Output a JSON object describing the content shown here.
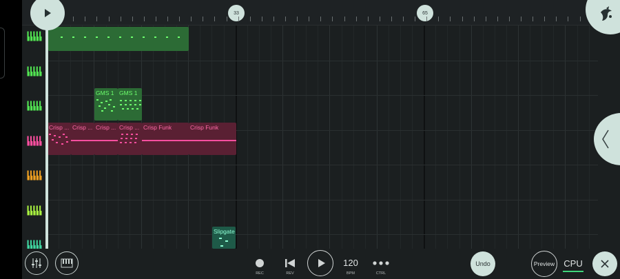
{
  "timeline": {
    "markers": [
      {
        "label": "33"
      },
      {
        "label": "65"
      }
    ]
  },
  "clips": {
    "gms_1a": "GMS 1",
    "gms_1b": "GMS 1",
    "crisp_1": "Crisp ...",
    "crisp_2": "Crisp ...",
    "crisp_3": "Crisp ...",
    "crisp_4": "Crisp ...",
    "crisp_funk_1": "Crisp Funk",
    "crisp_funk_2": "Crisp Funk",
    "slipgate": "Slipgate"
  },
  "transport": {
    "rec": "REC",
    "rev": "REV",
    "bpm_value": "120",
    "bpm": "BPM",
    "ctrl": "CTRL",
    "undo": "Undo",
    "preview": "Preview",
    "cpu": "CPU"
  },
  "colors": {
    "accent": "#cfe2dc",
    "green_clip": "#2f7a3a",
    "pink_clip": "#ff4fa0",
    "orange_track": "#f0a020",
    "teal_track": "#3fd6a0"
  },
  "icons": [
    "play-icon",
    "fl-fruit-logo-icon",
    "piano-keys-icon",
    "chevron-left-icon",
    "mixer-icon",
    "record-icon",
    "rewind-icon",
    "more-dots-icon",
    "close-icon"
  ]
}
